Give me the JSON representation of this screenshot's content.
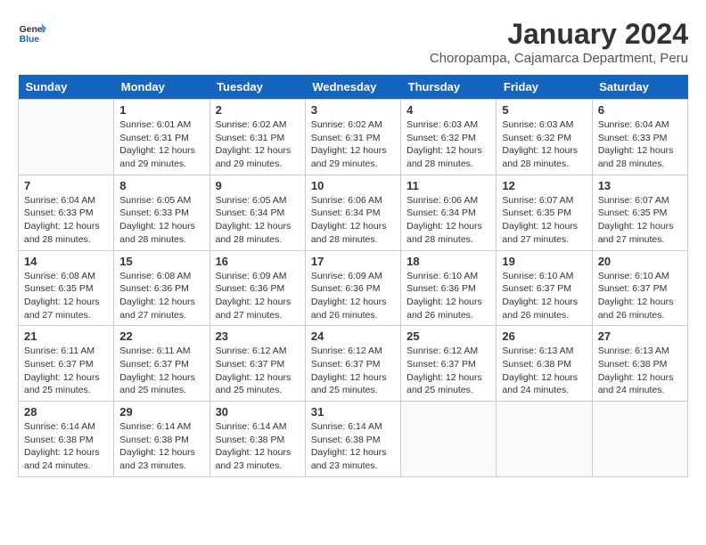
{
  "header": {
    "logo_general": "General",
    "logo_blue": "Blue",
    "title": "January 2024",
    "subtitle": "Choropampa, Cajamarca Department, Peru"
  },
  "days": [
    "Sunday",
    "Monday",
    "Tuesday",
    "Wednesday",
    "Thursday",
    "Friday",
    "Saturday"
  ],
  "weeks": [
    [
      {
        "date": "",
        "info": ""
      },
      {
        "date": "1",
        "info": "Sunrise: 6:01 AM\nSunset: 6:31 PM\nDaylight: 12 hours and 29 minutes."
      },
      {
        "date": "2",
        "info": "Sunrise: 6:02 AM\nSunset: 6:31 PM\nDaylight: 12 hours and 29 minutes."
      },
      {
        "date": "3",
        "info": "Sunrise: 6:02 AM\nSunset: 6:31 PM\nDaylight: 12 hours and 29 minutes."
      },
      {
        "date": "4",
        "info": "Sunrise: 6:03 AM\nSunset: 6:32 PM\nDaylight: 12 hours and 28 minutes."
      },
      {
        "date": "5",
        "info": "Sunrise: 6:03 AM\nSunset: 6:32 PM\nDaylight: 12 hours and 28 minutes."
      },
      {
        "date": "6",
        "info": "Sunrise: 6:04 AM\nSunset: 6:33 PM\nDaylight: 12 hours and 28 minutes."
      }
    ],
    [
      {
        "date": "7",
        "info": "Sunrise: 6:04 AM\nSunset: 6:33 PM\nDaylight: 12 hours and 28 minutes."
      },
      {
        "date": "8",
        "info": "Sunrise: 6:05 AM\nSunset: 6:33 PM\nDaylight: 12 hours and 28 minutes."
      },
      {
        "date": "9",
        "info": "Sunrise: 6:05 AM\nSunset: 6:34 PM\nDaylight: 12 hours and 28 minutes."
      },
      {
        "date": "10",
        "info": "Sunrise: 6:06 AM\nSunset: 6:34 PM\nDaylight: 12 hours and 28 minutes."
      },
      {
        "date": "11",
        "info": "Sunrise: 6:06 AM\nSunset: 6:34 PM\nDaylight: 12 hours and 28 minutes."
      },
      {
        "date": "12",
        "info": "Sunrise: 6:07 AM\nSunset: 6:35 PM\nDaylight: 12 hours and 27 minutes."
      },
      {
        "date": "13",
        "info": "Sunrise: 6:07 AM\nSunset: 6:35 PM\nDaylight: 12 hours and 27 minutes."
      }
    ],
    [
      {
        "date": "14",
        "info": "Sunrise: 6:08 AM\nSunset: 6:35 PM\nDaylight: 12 hours and 27 minutes."
      },
      {
        "date": "15",
        "info": "Sunrise: 6:08 AM\nSunset: 6:36 PM\nDaylight: 12 hours and 27 minutes."
      },
      {
        "date": "16",
        "info": "Sunrise: 6:09 AM\nSunset: 6:36 PM\nDaylight: 12 hours and 27 minutes."
      },
      {
        "date": "17",
        "info": "Sunrise: 6:09 AM\nSunset: 6:36 PM\nDaylight: 12 hours and 26 minutes."
      },
      {
        "date": "18",
        "info": "Sunrise: 6:10 AM\nSunset: 6:36 PM\nDaylight: 12 hours and 26 minutes."
      },
      {
        "date": "19",
        "info": "Sunrise: 6:10 AM\nSunset: 6:37 PM\nDaylight: 12 hours and 26 minutes."
      },
      {
        "date": "20",
        "info": "Sunrise: 6:10 AM\nSunset: 6:37 PM\nDaylight: 12 hours and 26 minutes."
      }
    ],
    [
      {
        "date": "21",
        "info": "Sunrise: 6:11 AM\nSunset: 6:37 PM\nDaylight: 12 hours and 25 minutes."
      },
      {
        "date": "22",
        "info": "Sunrise: 6:11 AM\nSunset: 6:37 PM\nDaylight: 12 hours and 25 minutes."
      },
      {
        "date": "23",
        "info": "Sunrise: 6:12 AM\nSunset: 6:37 PM\nDaylight: 12 hours and 25 minutes."
      },
      {
        "date": "24",
        "info": "Sunrise: 6:12 AM\nSunset: 6:37 PM\nDaylight: 12 hours and 25 minutes."
      },
      {
        "date": "25",
        "info": "Sunrise: 6:12 AM\nSunset: 6:37 PM\nDaylight: 12 hours and 25 minutes."
      },
      {
        "date": "26",
        "info": "Sunrise: 6:13 AM\nSunset: 6:38 PM\nDaylight: 12 hours and 24 minutes."
      },
      {
        "date": "27",
        "info": "Sunrise: 6:13 AM\nSunset: 6:38 PM\nDaylight: 12 hours and 24 minutes."
      }
    ],
    [
      {
        "date": "28",
        "info": "Sunrise: 6:14 AM\nSunset: 6:38 PM\nDaylight: 12 hours and 24 minutes."
      },
      {
        "date": "29",
        "info": "Sunrise: 6:14 AM\nSunset: 6:38 PM\nDaylight: 12 hours and 23 minutes."
      },
      {
        "date": "30",
        "info": "Sunrise: 6:14 AM\nSunset: 6:38 PM\nDaylight: 12 hours and 23 minutes."
      },
      {
        "date": "31",
        "info": "Sunrise: 6:14 AM\nSunset: 6:38 PM\nDaylight: 12 hours and 23 minutes."
      },
      {
        "date": "",
        "info": ""
      },
      {
        "date": "",
        "info": ""
      },
      {
        "date": "",
        "info": ""
      }
    ]
  ]
}
